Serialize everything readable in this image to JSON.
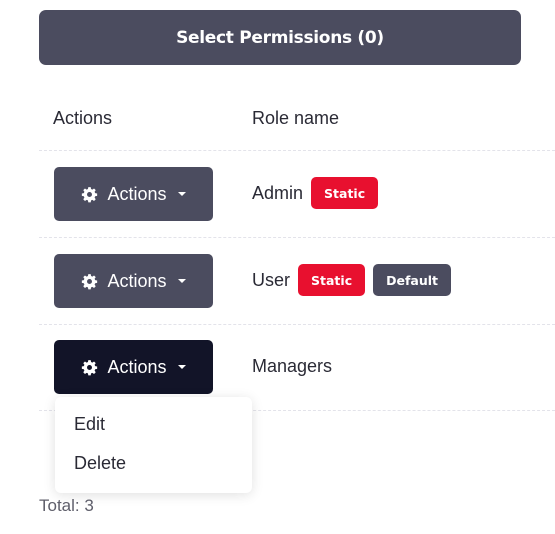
{
  "toolbar": {
    "select_permissions_label": "Select Permissions (0)"
  },
  "table": {
    "headers": {
      "actions": "Actions",
      "role_name": "Role name"
    },
    "rows": [
      {
        "actions_label": "Actions",
        "role_name": "Admin",
        "badges": [
          "Static"
        ]
      },
      {
        "actions_label": "Actions",
        "role_name": "User",
        "badges": [
          "Static",
          "Default"
        ]
      },
      {
        "actions_label": "Actions",
        "role_name": "Managers",
        "badges": []
      }
    ]
  },
  "dropdown": {
    "items": [
      "Edit",
      "Delete"
    ]
  },
  "footer": {
    "total": "Total: 3"
  },
  "icons": {
    "actions_button_icon": "gear-icon",
    "actions_button_caret": "caret-down-icon"
  },
  "colors": {
    "button_dark": "#4b4c5f",
    "button_active": "#121428",
    "badge_static": "#e8102f",
    "badge_default": "#4b4c5f"
  }
}
